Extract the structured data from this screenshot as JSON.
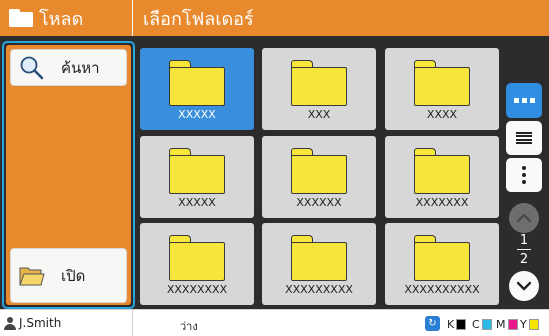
{
  "header": {
    "left_title": "โหลด",
    "right_title": "เลือกโฟลเดอร์"
  },
  "sidebar": {
    "search_label": "ค้นหา",
    "open_label": "เปิด"
  },
  "folders": [
    {
      "name": "XXXXX",
      "selected": true
    },
    {
      "name": "XXX",
      "selected": false
    },
    {
      "name": "XXXX",
      "selected": false
    },
    {
      "name": "XXXXX",
      "selected": false
    },
    {
      "name": "XXXXXX",
      "selected": false
    },
    {
      "name": "XXXXXXX",
      "selected": false
    },
    {
      "name": "XXXXXXXX",
      "selected": false
    },
    {
      "name": "XXXXXXXXX",
      "selected": false
    },
    {
      "name": "XXXXXXXXXX",
      "selected": false
    }
  ],
  "pager": {
    "current": "1",
    "total": "2"
  },
  "status": {
    "user": "J.Smith",
    "text": "ว่าง",
    "inks": [
      {
        "letter": "K",
        "color": "#000000"
      },
      {
        "letter": "C",
        "color": "#29b8e8"
      },
      {
        "letter": "M",
        "color": "#e8198b"
      },
      {
        "letter": "Y",
        "color": "#f5e400"
      }
    ]
  },
  "colors": {
    "accent": "#e8892d",
    "selected": "#3a8fdc",
    "frame": "#29a3e0"
  }
}
